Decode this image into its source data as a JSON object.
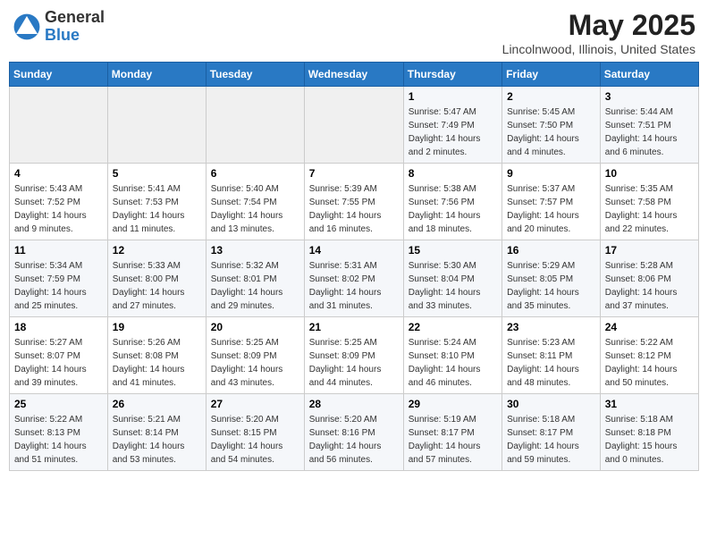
{
  "header": {
    "logo_general": "General",
    "logo_blue": "Blue",
    "title": "May 2025",
    "location": "Lincolnwood, Illinois, United States"
  },
  "days_of_week": [
    "Sunday",
    "Monday",
    "Tuesday",
    "Wednesday",
    "Thursday",
    "Friday",
    "Saturday"
  ],
  "weeks": [
    [
      {
        "day": "",
        "info": ""
      },
      {
        "day": "",
        "info": ""
      },
      {
        "day": "",
        "info": ""
      },
      {
        "day": "",
        "info": ""
      },
      {
        "day": "1",
        "info": "Sunrise: 5:47 AM\nSunset: 7:49 PM\nDaylight: 14 hours\nand 2 minutes."
      },
      {
        "day": "2",
        "info": "Sunrise: 5:45 AM\nSunset: 7:50 PM\nDaylight: 14 hours\nand 4 minutes."
      },
      {
        "day": "3",
        "info": "Sunrise: 5:44 AM\nSunset: 7:51 PM\nDaylight: 14 hours\nand 6 minutes."
      }
    ],
    [
      {
        "day": "4",
        "info": "Sunrise: 5:43 AM\nSunset: 7:52 PM\nDaylight: 14 hours\nand 9 minutes."
      },
      {
        "day": "5",
        "info": "Sunrise: 5:41 AM\nSunset: 7:53 PM\nDaylight: 14 hours\nand 11 minutes."
      },
      {
        "day": "6",
        "info": "Sunrise: 5:40 AM\nSunset: 7:54 PM\nDaylight: 14 hours\nand 13 minutes."
      },
      {
        "day": "7",
        "info": "Sunrise: 5:39 AM\nSunset: 7:55 PM\nDaylight: 14 hours\nand 16 minutes."
      },
      {
        "day": "8",
        "info": "Sunrise: 5:38 AM\nSunset: 7:56 PM\nDaylight: 14 hours\nand 18 minutes."
      },
      {
        "day": "9",
        "info": "Sunrise: 5:37 AM\nSunset: 7:57 PM\nDaylight: 14 hours\nand 20 minutes."
      },
      {
        "day": "10",
        "info": "Sunrise: 5:35 AM\nSunset: 7:58 PM\nDaylight: 14 hours\nand 22 minutes."
      }
    ],
    [
      {
        "day": "11",
        "info": "Sunrise: 5:34 AM\nSunset: 7:59 PM\nDaylight: 14 hours\nand 25 minutes."
      },
      {
        "day": "12",
        "info": "Sunrise: 5:33 AM\nSunset: 8:00 PM\nDaylight: 14 hours\nand 27 minutes."
      },
      {
        "day": "13",
        "info": "Sunrise: 5:32 AM\nSunset: 8:01 PM\nDaylight: 14 hours\nand 29 minutes."
      },
      {
        "day": "14",
        "info": "Sunrise: 5:31 AM\nSunset: 8:02 PM\nDaylight: 14 hours\nand 31 minutes."
      },
      {
        "day": "15",
        "info": "Sunrise: 5:30 AM\nSunset: 8:04 PM\nDaylight: 14 hours\nand 33 minutes."
      },
      {
        "day": "16",
        "info": "Sunrise: 5:29 AM\nSunset: 8:05 PM\nDaylight: 14 hours\nand 35 minutes."
      },
      {
        "day": "17",
        "info": "Sunrise: 5:28 AM\nSunset: 8:06 PM\nDaylight: 14 hours\nand 37 minutes."
      }
    ],
    [
      {
        "day": "18",
        "info": "Sunrise: 5:27 AM\nSunset: 8:07 PM\nDaylight: 14 hours\nand 39 minutes."
      },
      {
        "day": "19",
        "info": "Sunrise: 5:26 AM\nSunset: 8:08 PM\nDaylight: 14 hours\nand 41 minutes."
      },
      {
        "day": "20",
        "info": "Sunrise: 5:25 AM\nSunset: 8:09 PM\nDaylight: 14 hours\nand 43 minutes."
      },
      {
        "day": "21",
        "info": "Sunrise: 5:25 AM\nSunset: 8:09 PM\nDaylight: 14 hours\nand 44 minutes."
      },
      {
        "day": "22",
        "info": "Sunrise: 5:24 AM\nSunset: 8:10 PM\nDaylight: 14 hours\nand 46 minutes."
      },
      {
        "day": "23",
        "info": "Sunrise: 5:23 AM\nSunset: 8:11 PM\nDaylight: 14 hours\nand 48 minutes."
      },
      {
        "day": "24",
        "info": "Sunrise: 5:22 AM\nSunset: 8:12 PM\nDaylight: 14 hours\nand 50 minutes."
      }
    ],
    [
      {
        "day": "25",
        "info": "Sunrise: 5:22 AM\nSunset: 8:13 PM\nDaylight: 14 hours\nand 51 minutes."
      },
      {
        "day": "26",
        "info": "Sunrise: 5:21 AM\nSunset: 8:14 PM\nDaylight: 14 hours\nand 53 minutes."
      },
      {
        "day": "27",
        "info": "Sunrise: 5:20 AM\nSunset: 8:15 PM\nDaylight: 14 hours\nand 54 minutes."
      },
      {
        "day": "28",
        "info": "Sunrise: 5:20 AM\nSunset: 8:16 PM\nDaylight: 14 hours\nand 56 minutes."
      },
      {
        "day": "29",
        "info": "Sunrise: 5:19 AM\nSunset: 8:17 PM\nDaylight: 14 hours\nand 57 minutes."
      },
      {
        "day": "30",
        "info": "Sunrise: 5:18 AM\nSunset: 8:17 PM\nDaylight: 14 hours\nand 59 minutes."
      },
      {
        "day": "31",
        "info": "Sunrise: 5:18 AM\nSunset: 8:18 PM\nDaylight: 15 hours\nand 0 minutes."
      }
    ]
  ]
}
